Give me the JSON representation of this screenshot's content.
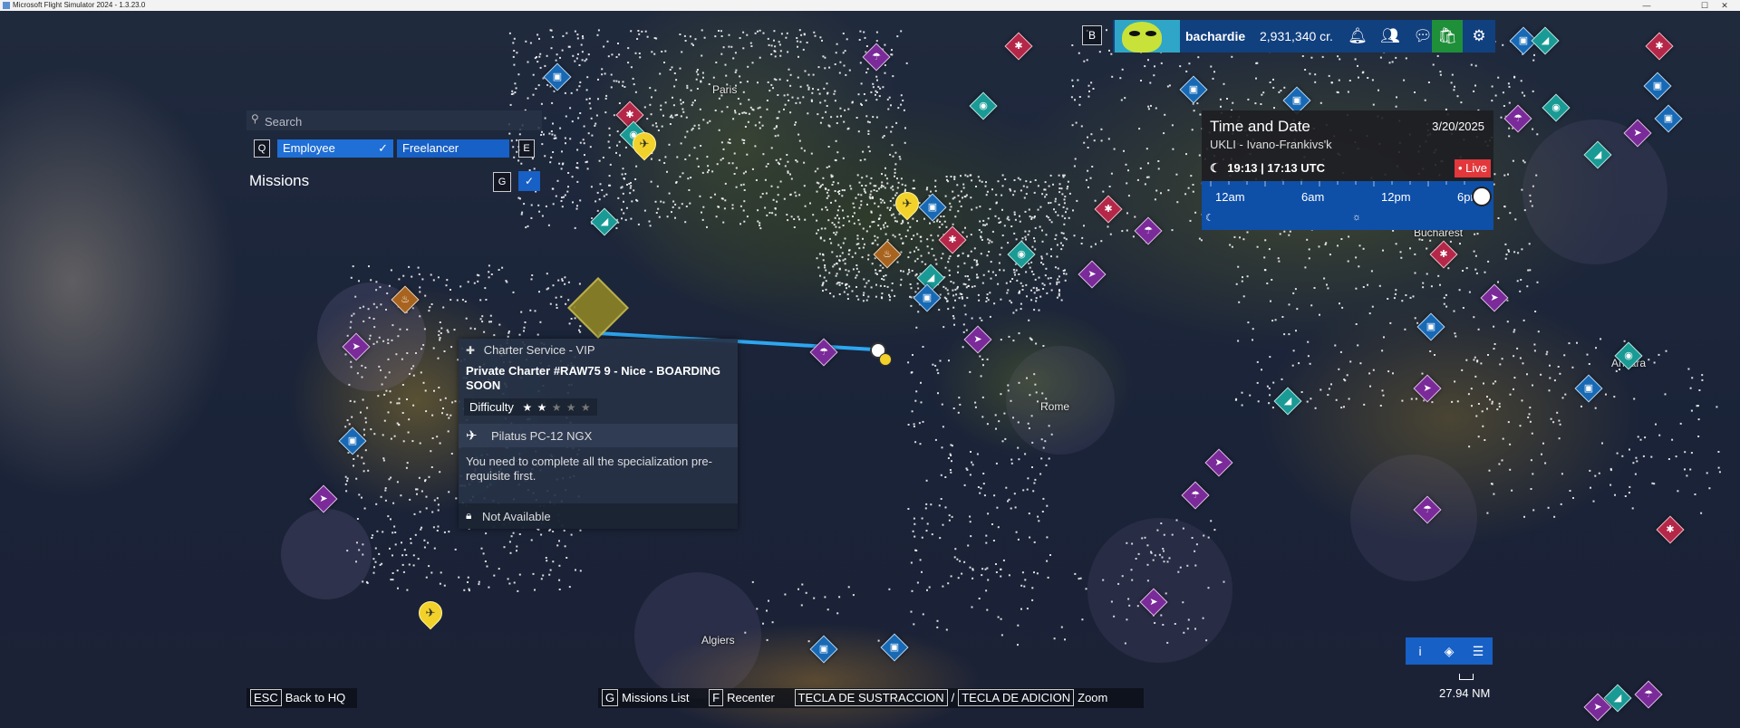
{
  "window": {
    "title": "Microsoft Flight Simulator 2024 - 1.3.23.0",
    "minimize_glyph": "—",
    "maximize_glyph": "☐",
    "close_glyph": "✕"
  },
  "search": {
    "placeholder": "Search",
    "icon": "search-icon"
  },
  "filters": {
    "prev_key": "Q",
    "next_key": "E",
    "tabs": [
      {
        "label": "Employee",
        "selected": true
      },
      {
        "label": "Freelancer",
        "selected": false
      }
    ],
    "check_glyph": "✓"
  },
  "missions": {
    "title": "Missions",
    "toggle_key": "G",
    "dropdown_glyph": "✓"
  },
  "map_labels": {
    "paris": "Paris",
    "rome": "Rome",
    "algiers": "Algiers",
    "bucharest": "Bucharest",
    "ankara": "Ankara"
  },
  "mission_card": {
    "category": "Charter Service - VIP",
    "title": "Private Charter #RAW75 9 - Nice - BOARDING SOON",
    "difficulty_label": "Difficulty",
    "difficulty_stars_on": "★ ★",
    "difficulty_stars_off": "★ ★ ★",
    "difficulty_value": 2,
    "difficulty_max": 5,
    "aircraft": "Pilatus PC-12 NGX",
    "message": "You need to complete all the specialization pre-requisite first.",
    "availability": "Not Available"
  },
  "time_panel": {
    "title": "Time and Date",
    "date": "3/20/2025",
    "location": "UKLI - Ivano-Frankivs'k",
    "time": "19:13 | 17:13 UTC",
    "live_label": "• Live",
    "scale_labels": [
      "12am",
      "6am",
      "12pm",
      "6pm"
    ]
  },
  "user": {
    "bar_key": "B",
    "name": "bachardie",
    "credits": "2,931,340 cr."
  },
  "hints": {
    "back": {
      "key": "ESC",
      "label": "Back to HQ"
    },
    "missions_list": {
      "key": "G",
      "label": "Missions List"
    },
    "recenter": {
      "key": "F",
      "label": "Recenter"
    },
    "zoom_out_key": "TECLA DE SUSTRACCION",
    "separator": "/",
    "zoom_in_key": "TECLA DE ADICION",
    "zoom_label": "Zoom"
  },
  "map_controls": {
    "info": "i",
    "layers": "◈",
    "legend": "☰"
  },
  "scale": {
    "value": "27.94 NM"
  },
  "colors": {
    "accent_blue": "#1760c6",
    "tab_selected": "#1f6fd6",
    "live_red": "#e2373b",
    "pin_yellow": "#f2d22a",
    "poi_blue": "#1769b5",
    "poi_teal": "#1a9a95",
    "poi_red": "#b52748",
    "poi_purple": "#7b2a9a",
    "poi_orange": "#a8641f"
  }
}
